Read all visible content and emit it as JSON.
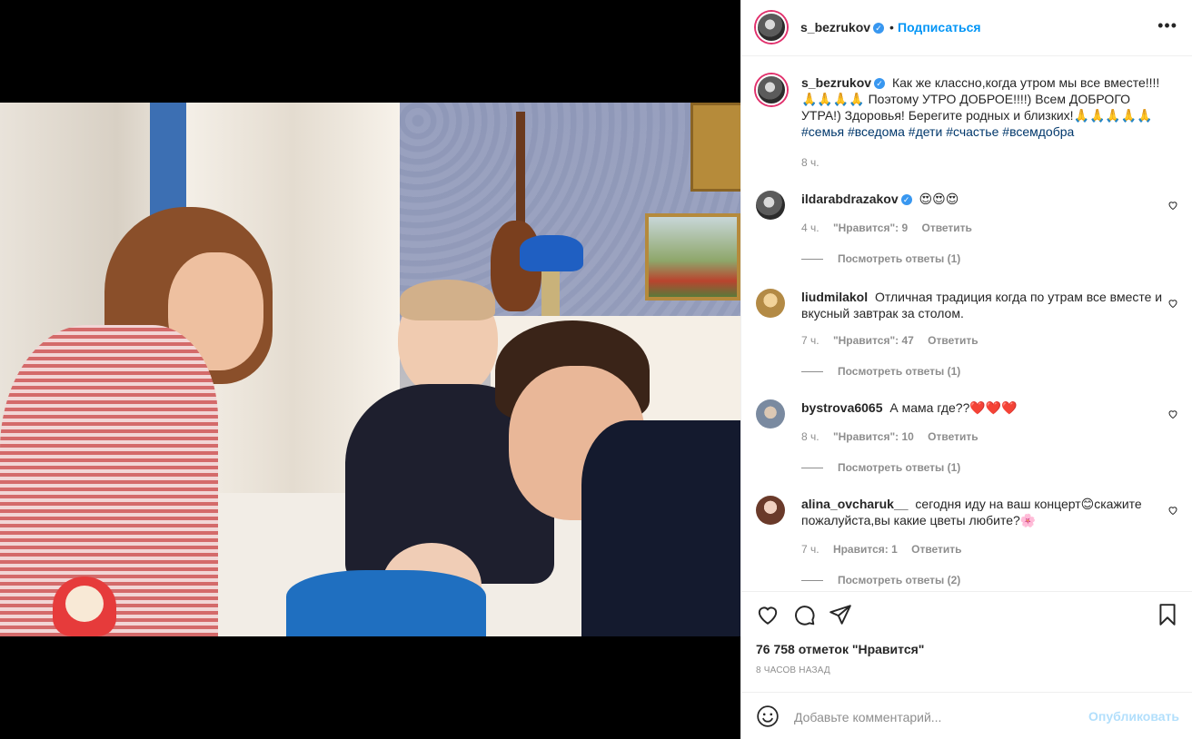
{
  "post": {
    "author": "s_bezrukov",
    "follow_label": "Подписаться",
    "more_label": "•••",
    "caption_lines": [
      "Как же классно,когда утром мы все вместе!!!! 🙏🙏🙏🙏 Поэтому УТРО ДОБРОЕ!!!!) Всем ДОБРОГО УТРА!) Здоровья! Берегите родных и близких!🙏🙏🙏🙏🙏"
    ],
    "hashtags": [
      "#семья",
      "#вседома",
      "#дети",
      "#счастье",
      "#всемдобра"
    ],
    "caption_time": "8 ч."
  },
  "comments": [
    {
      "user": "ildarabdrazakov",
      "verified": true,
      "text": "😍😍😍",
      "time": "4 ч.",
      "likes": "\"Нравится\": 9",
      "reply_label": "Ответить",
      "view_replies": "Посмотреть ответы (1)"
    },
    {
      "user": "liudmilakol",
      "verified": false,
      "text": "Отличная традиция когда по утрам все вместе и вкусный завтрак за столом.",
      "time": "7 ч.",
      "likes": "\"Нравится\": 47",
      "reply_label": "Ответить",
      "view_replies": "Посмотреть ответы (1)"
    },
    {
      "user": "bystrova6065",
      "verified": false,
      "text": "А мама где??❤️❤️❤️",
      "time": "8 ч.",
      "likes": "\"Нравится\": 10",
      "reply_label": "Ответить",
      "view_replies": "Посмотреть ответы (1)"
    },
    {
      "user": "alina_ovcharuk__",
      "verified": false,
      "text": "сегодня иду на ваш концерт😊скажите пожалуйста,вы какие цветы любите?🌸",
      "time": "7 ч.",
      "likes": "Нравится: 1",
      "reply_label": "Ответить",
      "view_replies": "Посмотреть ответы (2)"
    }
  ],
  "stats": {
    "likes": "76 758 отметок \"Нравится\"",
    "timestamp": "8 ЧАСОВ НАЗАД"
  },
  "add_comment": {
    "placeholder": "Добавьте комментарий...",
    "publish_label": "Опубликовать"
  },
  "icons": {
    "like": "heart-icon",
    "comment": "comment-icon",
    "share": "paper-plane-icon",
    "save": "bookmark-icon",
    "emoji": "smiley-icon",
    "verified": "verified-badge-icon"
  },
  "colors": {
    "link_blue": "#0095f6",
    "hashtag_blue": "#00376b",
    "muted_gray": "#8e8e8e",
    "publish_disabled": "#b2dffc",
    "story_ring": "#e1306c"
  }
}
